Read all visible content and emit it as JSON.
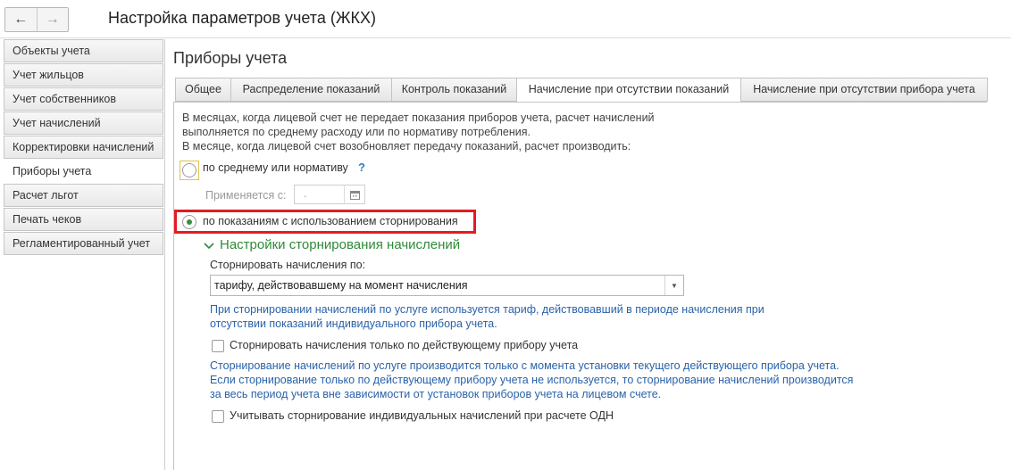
{
  "window": {
    "title": "Настройка параметров учета (ЖКХ)",
    "back_icon": "arrow-left-icon",
    "forward_icon": "arrow-right-icon"
  },
  "sidebar": {
    "items": [
      {
        "label": "Объекты учета"
      },
      {
        "label": "Учет жильцов"
      },
      {
        "label": "Учет собственников"
      },
      {
        "label": "Учет начислений"
      },
      {
        "label": "Корректировки начислений"
      },
      {
        "label": "Приборы учета",
        "active": true
      },
      {
        "label": "Расчет льгот"
      },
      {
        "label": "Печать чеков"
      },
      {
        "label": "Регламентированный учет"
      }
    ]
  },
  "main": {
    "title": "Приборы учета",
    "tabs": [
      {
        "label": "Общее"
      },
      {
        "label": "Распределение показаний"
      },
      {
        "label": "Контроль показаний"
      },
      {
        "label": "Начисление при отсутствии показаний",
        "active": true
      },
      {
        "label": "Начисление при отсутствии прибора учета"
      }
    ],
    "description": {
      "line1": "В месяцах, когда лицевой счет не передает показания приборов учета, расчет начислений",
      "line2": "выполняется по среднему расходу или по нормативу потребления.",
      "line3": "В месяце, когда лицевой счет возобновляет передачу показаний, расчет производить:"
    },
    "option_average": {
      "label": "по среднему или нормативу",
      "help": "?",
      "selected": false
    },
    "applies_from": {
      "label": "Применяется с:",
      "value": ".",
      "calendar_icon": "calendar-icon"
    },
    "option_readings": {
      "label": "по показаниям с использованием сторнирования",
      "selected": true
    },
    "storno": {
      "section_title": "Настройки сторнирования начислений",
      "field_label": "Сторнировать начисления по:",
      "select_value": "тарифу, действовавшему на момент начисления",
      "info1_line1": "При сторнировании начислений по услуге используется тариф, действовавший в периоде начисления при",
      "info1_line2": "отсутствии показаний индивидуального прибора учета.",
      "checkbox1_label": "Сторнировать начисления только по действующему прибору учета",
      "checkbox1_checked": false,
      "info2_line1": "Сторнирование начислений по услуге производится только с момента установки текущего действующего прибора учета.",
      "info2_line2": "Если сторнирование только по действующему прибору учета не используется, то сторнирование начислений производится",
      "info2_line3": "за весь период учета вне зависимости от установок приборов учета на лицевом счете.",
      "checkbox2_label": "Учитывать сторнирование индивидуальных начислений при расчете ОДН",
      "checkbox2_checked": false
    }
  },
  "colors": {
    "accent_green": "#2f8a3a",
    "info_blue": "#2a62a8",
    "highlight_red": "#e31b23"
  }
}
